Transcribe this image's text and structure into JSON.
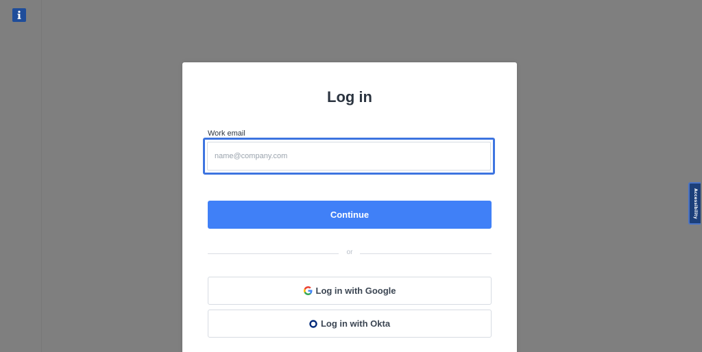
{
  "login": {
    "title": "Log in",
    "email_label": "Work email",
    "email_placeholder": "name@company.com",
    "email_value": "",
    "continue_label": "Continue",
    "divider_text": "or",
    "google_label": "Log in with Google",
    "okta_label": "Log in with Okta"
  },
  "accessibility_tab": {
    "label": "Accessibility"
  },
  "icons": {
    "info": "info-icon",
    "google": "google-icon",
    "okta": "okta-icon"
  },
  "colors": {
    "backdrop": "#7f7f7f",
    "primary": "#4080f7",
    "focus_ring": "#3d74e0",
    "info_badge": "#1f4d9a",
    "accessibility_tab": "#1c3f7a"
  }
}
